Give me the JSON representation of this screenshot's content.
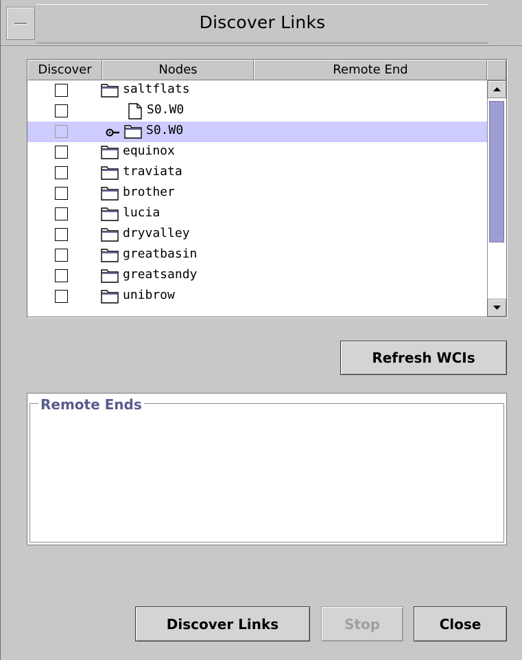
{
  "window": {
    "title": "Discover Links"
  },
  "table": {
    "columns": [
      "Discover",
      "Nodes",
      "Remote End"
    ],
    "rows": [
      {
        "label": "saltflats",
        "icon": "folder-icon",
        "indent": 0,
        "selected": false,
        "checked": false
      },
      {
        "label": "S0.W0",
        "icon": "file-icon",
        "indent": 1,
        "selected": false,
        "checked": false
      },
      {
        "label": "S0.W0",
        "icon": "folder-icon",
        "indent": 0,
        "selected": true,
        "checked": false,
        "key_icon": "key-icon"
      },
      {
        "label": "equinox",
        "icon": "folder-icon",
        "indent": 0,
        "selected": false,
        "checked": false
      },
      {
        "label": "traviata",
        "icon": "folder-icon",
        "indent": 0,
        "selected": false,
        "checked": false
      },
      {
        "label": "brother",
        "icon": "folder-icon",
        "indent": 0,
        "selected": false,
        "checked": false
      },
      {
        "label": "lucia",
        "icon": "folder-icon",
        "indent": 0,
        "selected": false,
        "checked": false
      },
      {
        "label": "dryvalley",
        "icon": "folder-icon",
        "indent": 0,
        "selected": false,
        "checked": false
      },
      {
        "label": "greatbasin",
        "icon": "folder-icon",
        "indent": 0,
        "selected": false,
        "checked": false
      },
      {
        "label": "greatsandy",
        "icon": "folder-icon",
        "indent": 0,
        "selected": false,
        "checked": false
      },
      {
        "label": "unibrow",
        "icon": "folder-icon",
        "indent": 0,
        "selected": false,
        "checked": false
      }
    ]
  },
  "buttons": {
    "refresh": "Refresh WCIs",
    "discover": "Discover Links",
    "stop": "Stop",
    "close": "Close"
  },
  "remote_ends": {
    "title": "Remote Ends"
  },
  "colors": {
    "selection": "#ccccff",
    "thumb": "#a6a6d6",
    "group_title": "#5a5a8f"
  }
}
